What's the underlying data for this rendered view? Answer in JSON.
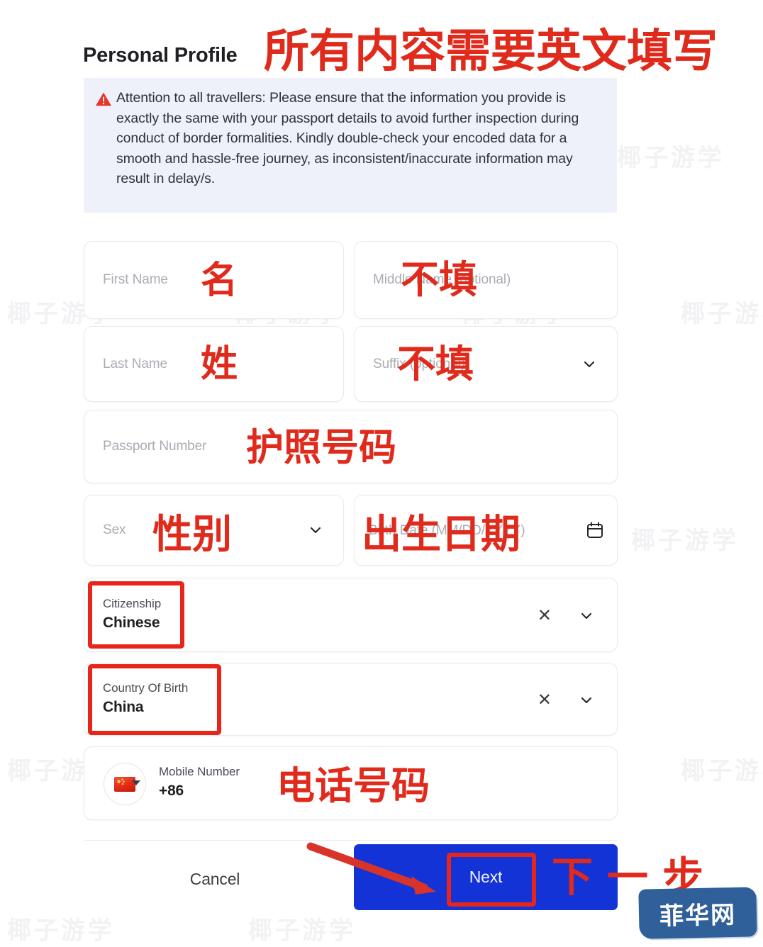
{
  "page_title": "Personal Profile",
  "alert": {
    "icon": "warning-triangle-icon",
    "text": "Attention to all travellers: Please ensure that the information you provide is exactly the same with your passport details to avoid further inspection during conduct of border formalities. Kindly double-check your encoded data for a smooth and hassle-free journey, as inconsistent/inaccurate information may result in delay/s."
  },
  "form": {
    "first_name": {
      "placeholder": "First Name",
      "value": ""
    },
    "middle_name": {
      "placeholder": "Middle Name (optional)",
      "value": ""
    },
    "last_name": {
      "placeholder": "Last Name",
      "value": ""
    },
    "suffix": {
      "placeholder": "Suffix (optional)",
      "value": ""
    },
    "passport_number": {
      "placeholder": "Passport Number",
      "value": ""
    },
    "sex": {
      "placeholder": "Sex",
      "value": ""
    },
    "birth_date": {
      "placeholder": "Birth Date (MM/DD/YYYY)",
      "value": ""
    },
    "citizenship": {
      "label": "Citizenship",
      "value": "Chinese"
    },
    "country_of_birth": {
      "label": "Country Of Birth",
      "value": "China"
    },
    "mobile_number": {
      "label": "Mobile Number",
      "value": "+86",
      "flag": "china-flag-icon"
    }
  },
  "footer": {
    "cancel_label": "Cancel",
    "next_label": "Next"
  },
  "annotations": {
    "header_note": "所有内容需要英文填写",
    "first_name_note": "名",
    "middle_name_note": "不填",
    "last_name_note": "姓",
    "suffix_note": "不填",
    "passport_note": "护照号码",
    "sex_note": "性别",
    "birth_date_note": "出生日期",
    "mobile_note": "电话号码",
    "next_note": "下一步"
  },
  "watermark": {
    "text": "椰子游学",
    "stamp": "菲华网"
  },
  "colors": {
    "annotation_red": "#e02a1c",
    "primary_blue": "#1433d6",
    "alert_bg": "#eef0fa",
    "stamp_blue": "#2f6099"
  }
}
